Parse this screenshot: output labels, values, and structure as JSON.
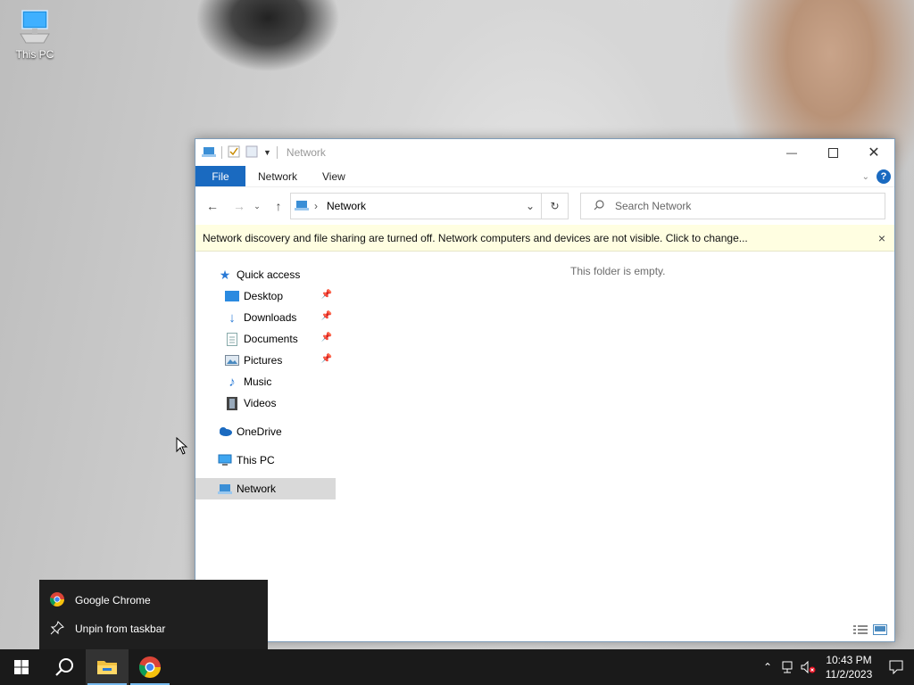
{
  "desktop": {
    "icons": [
      {
        "label": "This PC",
        "icon": "monitor-icon"
      }
    ]
  },
  "window": {
    "title": "Network",
    "quick_access_icons": [
      "network-icon",
      "properties-icon",
      "new-folder-icon",
      "customize-arrow-icon"
    ],
    "ribbon_tabs": {
      "file": "File",
      "network": "Network",
      "view": "View"
    },
    "address": {
      "crumb": "Network"
    },
    "search": {
      "placeholder": "Search Network"
    },
    "infobar": {
      "message": "Network discovery and file sharing are turned off. Network computers and devices are not visible. Click to change...",
      "close": "×"
    },
    "nav_pane": {
      "quick_access": "Quick access",
      "items": [
        {
          "label": "Desktop",
          "pinned": true,
          "icon": "desktop-folder-icon"
        },
        {
          "label": "Downloads",
          "pinned": true,
          "icon": "download-arrow-icon"
        },
        {
          "label": "Documents",
          "pinned": true,
          "icon": "documents-icon"
        },
        {
          "label": "Pictures",
          "pinned": true,
          "icon": "pictures-icon"
        },
        {
          "label": "Music",
          "pinned": false,
          "icon": "music-note-icon"
        },
        {
          "label": "Videos",
          "pinned": false,
          "icon": "film-icon"
        }
      ],
      "onedrive": "OneDrive",
      "this_pc": "This PC",
      "network": "Network"
    },
    "content": {
      "empty_message": "This folder is empty."
    }
  },
  "jumplist": {
    "items": [
      {
        "label": "Google Chrome",
        "icon": "chrome-icon"
      },
      {
        "label": "Unpin from taskbar",
        "icon": "unpin-icon"
      }
    ]
  },
  "taskbar": {
    "pinned": [
      "start-icon",
      "search-icon",
      "file-explorer-icon",
      "chrome-icon"
    ],
    "clock": {
      "time": "10:43 PM",
      "date": "11/2/2023"
    }
  },
  "colors": {
    "accent": "#1a6ac0",
    "infobar_bg": "#fffee1",
    "taskbar_bg": "#1a1a1a"
  }
}
